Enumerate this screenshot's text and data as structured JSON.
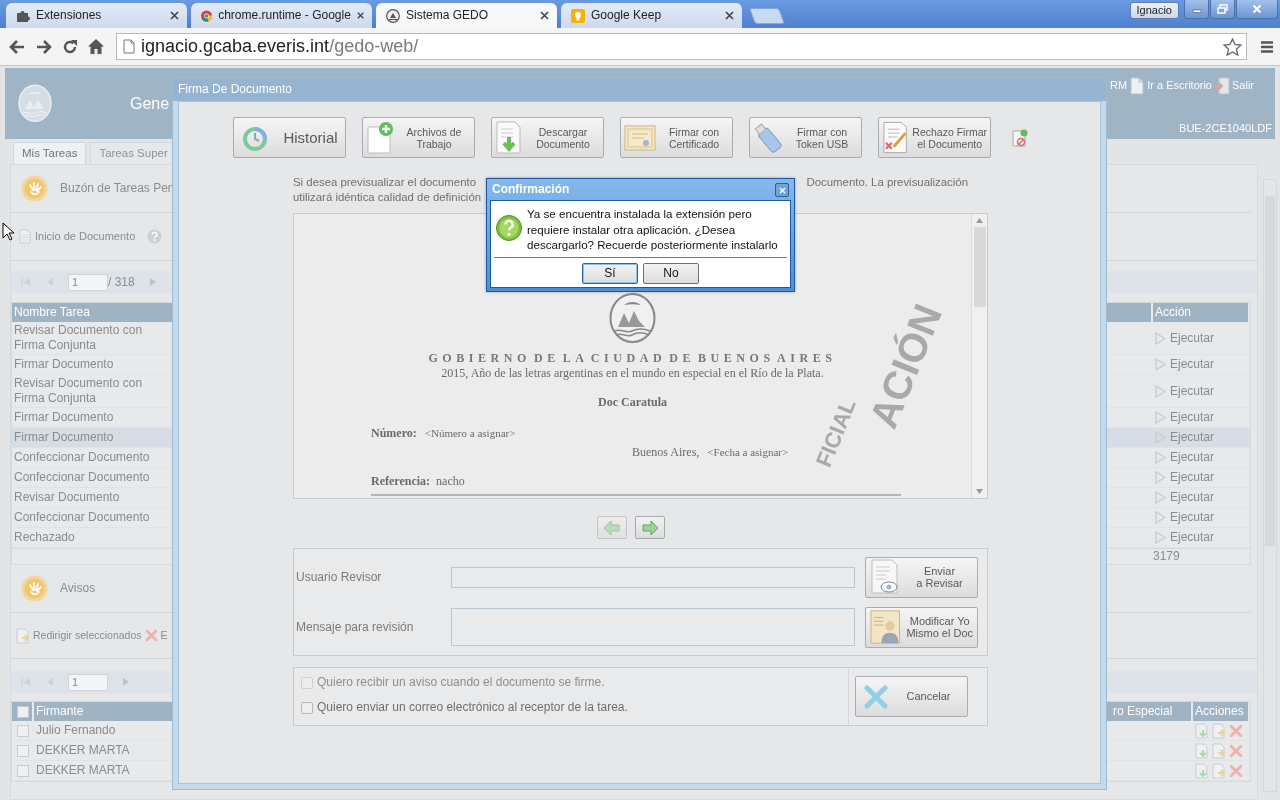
{
  "browser": {
    "tabs": [
      {
        "title": "Extensiones",
        "selected": false
      },
      {
        "title": "chrome.runtime - Google",
        "selected": false
      },
      {
        "title": "Sistema GEDO",
        "selected": true
      },
      {
        "title": "Google Keep",
        "selected": false
      }
    ],
    "profile": "Ignacio",
    "address": {
      "host": "ignacio.gcaba.everis.int",
      "path": "/gedo-web/"
    }
  },
  "app": {
    "header": {
      "title": "Gene",
      "links": [
        {
          "label": "RM"
        },
        {
          "label": "Ir a Escritorio"
        },
        {
          "label": "Salir"
        }
      ],
      "user_code": "BUE-2CE1040LDF"
    },
    "tabs": [
      {
        "label": "Mis Tareas",
        "selected": true
      },
      {
        "label": "Tareas Super",
        "selected": false
      }
    ],
    "inbox": {
      "title": "Buzón de Tareas Pen",
      "start_link": "Inicio de Documento",
      "pager": {
        "page": "1",
        "total": "/ 318"
      },
      "columns": [
        "Nombre Tarea",
        "Acción"
      ],
      "rows": [
        {
          "task": "Revisar Documento con Firma Conjunta",
          "action": "Ejecutar",
          "selected": false
        },
        {
          "task": "Firmar Documento",
          "action": "Ejecutar",
          "selected": false
        },
        {
          "task": "Revisar Documento con Firma Conjunta",
          "action": "Ejecutar",
          "selected": false
        },
        {
          "task": "Firmar Documento",
          "action": "Ejecutar",
          "selected": false
        },
        {
          "task": "Firmar Documento",
          "action": "Ejecutar",
          "selected": true
        },
        {
          "task": "Confeccionar Documento",
          "action": "Ejecutar",
          "selected": false
        },
        {
          "task": "Confeccionar Documento",
          "action": "Ejecutar",
          "selected": false
        },
        {
          "task": "Revisar Documento",
          "action": "Ejecutar",
          "selected": false
        },
        {
          "task": "Confeccionar Documento",
          "action": "Ejecutar",
          "selected": false
        },
        {
          "task": "Rechazado",
          "action": "Ejecutar",
          "selected": false
        }
      ],
      "footer": "3179"
    },
    "notices": {
      "title": "Avisos",
      "actions": [
        {
          "label": "Redirigir seleccionados"
        },
        {
          "label": "E"
        }
      ],
      "pager": {
        "page": "1"
      },
      "select_all": {
        "checked": false
      },
      "columns": [
        "Firmante",
        "ro Especial",
        "Acciones"
      ],
      "rows": [
        {
          "signer": "Julio Fernando",
          "checked": false
        },
        {
          "signer": "DEKKER MARTA",
          "checked": false
        },
        {
          "signer": "DEKKER MARTA",
          "checked": false
        }
      ]
    }
  },
  "modal": {
    "title": "Firma De Documento",
    "toolbar": [
      {
        "lines": [
          "Historial"
        ],
        "kind": "large"
      },
      {
        "lines": [
          "Archivos de",
          "Trabajo"
        ],
        "kind": "normal"
      },
      {
        "lines": [
          "Descargar",
          "Documento"
        ],
        "kind": "normal"
      },
      {
        "lines": [
          "Firmar con",
          "Certificado"
        ],
        "kind": "normal"
      },
      {
        "lines": [
          "Firmar con",
          "Token USB"
        ],
        "kind": "normal"
      },
      {
        "lines": [
          "Rechazo Firmar",
          "el Documento"
        ],
        "kind": "normal"
      }
    ],
    "notice_lines": [
      {
        "left": "Si desea previsualizar el documento",
        "right": "Documento. La previsualización"
      },
      {
        "left": "utilizará idéntica calidad de definición"
      }
    ],
    "document": {
      "heading": "GOBIERNO DE LA CIUDAD DE BUENOS AIRES",
      "motto": "2015, Año de las letras argentinas en el mundo en especial en el Río de la Plata.",
      "title": "Doc Caratula",
      "number_label": "Número:",
      "number_value": "<Número a asignar>",
      "place": "Buenos Aires,",
      "date": "<Fecha a asignar>",
      "reference_label": "Referencia:",
      "reference_value": "nacho",
      "stamp": [
        "ACIÓN",
        "FICIAL"
      ]
    },
    "nav": [
      {
        "disabled": true
      },
      {
        "disabled": false
      }
    ],
    "review": {
      "user_label": "Usuario Revisor",
      "message_label": "Mensaje para revisión",
      "send_button": [
        "Enviar",
        "a Revisar"
      ],
      "modify_button": [
        "Modificar Yo",
        "Mismo el Doc"
      ]
    },
    "options": [
      {
        "label": "Quiero recibir un aviso cuando el documento se firme.",
        "checked": false,
        "disabled": true
      },
      {
        "label": "Quiero enviar un correo electrónico al receptor de la tarea.",
        "checked": false,
        "disabled": false
      }
    ],
    "cancel": "Cancelar"
  },
  "dialog": {
    "title": "Confirmación",
    "message_lines": [
      "Ya se encuentra instalada la extensión pero",
      "requiere instalar otra aplicación. ¿Desea",
      "descargarlo? Recuerde posteriormente instalarlo"
    ],
    "buttons": [
      {
        "label": "Sí",
        "selected": true
      },
      {
        "label": "No",
        "selected": false
      }
    ]
  }
}
